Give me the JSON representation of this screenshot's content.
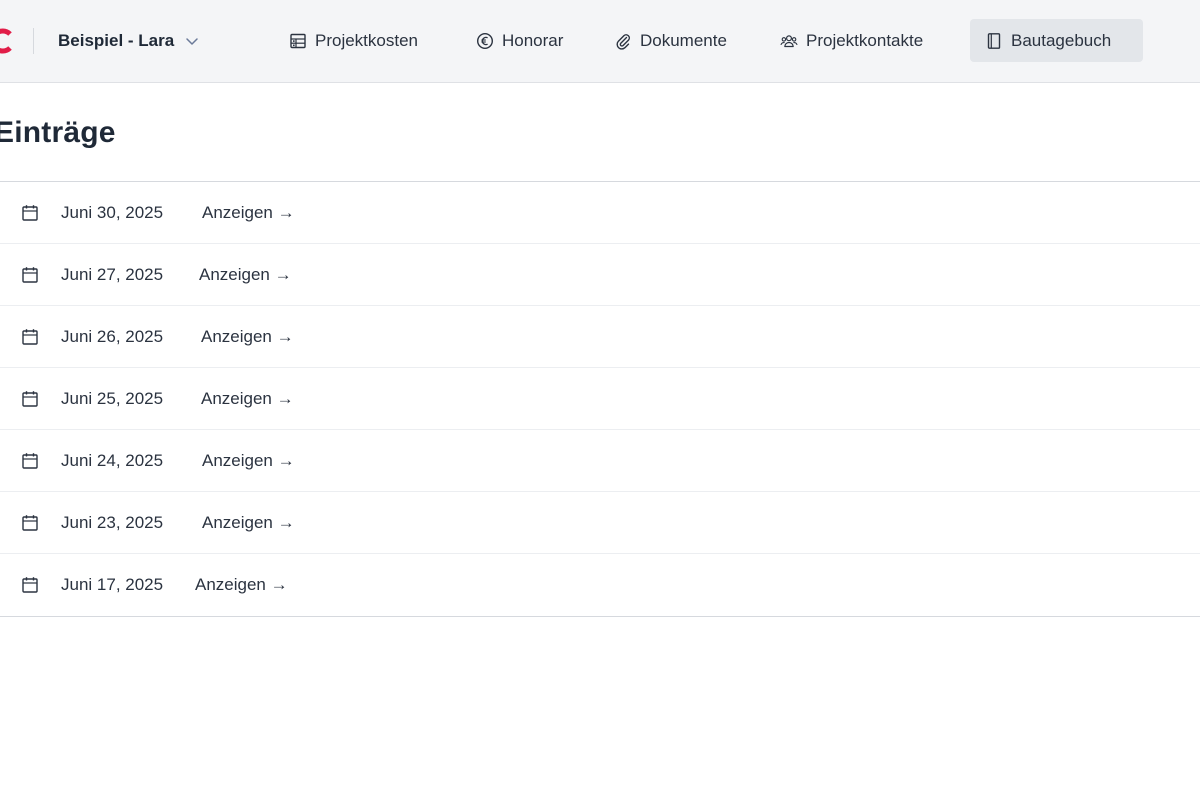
{
  "header": {
    "project_name": "Beispiel - Lara",
    "nav": [
      {
        "label": "Projektkosten",
        "icon": "table-icon"
      },
      {
        "label": "Honorar",
        "icon": "euro-icon"
      },
      {
        "label": "Dokumente",
        "icon": "paperclip-icon"
      },
      {
        "label": "Projektkontakte",
        "icon": "users-icon"
      },
      {
        "label": "Bautagebuch",
        "icon": "book-icon",
        "active": true
      }
    ]
  },
  "page": {
    "title": "Einträge"
  },
  "entries": [
    {
      "date": "Juni 30, 2025",
      "action": "Anzeigen →"
    },
    {
      "date": "Juni 27, 2025",
      "action": "Anzeigen →"
    },
    {
      "date": "Juni 26, 2025",
      "action": "Anzeigen →"
    },
    {
      "date": "Juni 25, 2025",
      "action": "Anzeigen →"
    },
    {
      "date": "Juni 24, 2025",
      "action": "Anzeigen →"
    },
    {
      "date": "Juni 23, 2025",
      "action": "Anzeigen →"
    },
    {
      "date": "Juni 17, 2025",
      "action": "Anzeigen →"
    }
  ],
  "colors": {
    "brand": "#e11d48",
    "header_bg": "#f4f5f7",
    "active_nav_bg": "#e3e6ea"
  }
}
